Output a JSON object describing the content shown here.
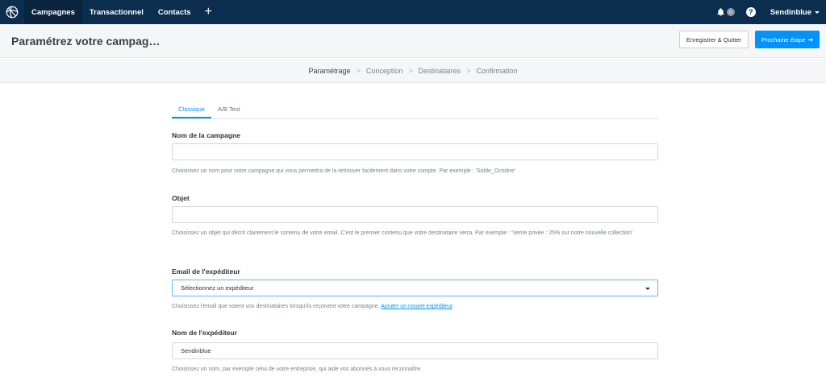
{
  "nav": {
    "items": [
      {
        "label": "Campagnes",
        "active": true
      },
      {
        "label": "Transactionnel",
        "active": false
      },
      {
        "label": "Contacts",
        "active": false
      }
    ],
    "plus_icon": "plus-icon",
    "notification_count": "0",
    "help_icon": "?",
    "account_label": "Sendinblue"
  },
  "header": {
    "title": "Paramétrez votre campag…",
    "save_label": "Enregistrer & Quitter",
    "next_label": "Prochaine étape",
    "next_arrow": "➔"
  },
  "stepper": {
    "steps": [
      "Paramétrage",
      "Conception",
      "Destinataires",
      "Confirmation"
    ],
    "active_index": 0,
    "separator": ">"
  },
  "form": {
    "tabs": [
      {
        "label": "Classique",
        "active": true
      },
      {
        "label": "A/B Test",
        "active": false
      }
    ],
    "fields": {
      "campaign_name": {
        "label": "Nom de la campagne",
        "value": "",
        "help": "Choisissez un nom pour votre campagne qui vous permettra de la retrouver facilement dans votre compte. Par exemple : 'Solde_Octobre'"
      },
      "subject": {
        "label": "Objet",
        "value": "",
        "help": "Choisissez un objet qui décrit clairement le contenu de votre email. C'est le premier contenu que votre destinataire verra. Par exemple : 'Vente privée : 25% sur notre nouvelle collection'"
      },
      "sender_email": {
        "label": "Email de l'expéditeur",
        "selected": "Sélectionnez un expéditeur",
        "help": "Choisissez l'email que voient vos destinataires lorsqu'ils reçoivent votre campagne.",
        "help_link": "Ajouter un nouvel expéditeur",
        "help_suffix": "."
      },
      "sender_name": {
        "label": "Nom de l'expéditeur",
        "value": "Sendinblue",
        "help": "Choisissez un nom, par exemple celui de votre entreprise, qui aide vos abonnés à vous reconnaître."
      }
    }
  },
  "colors": {
    "nav_bg": "#0b2e4f",
    "primary": "#0092ff",
    "header_bg": "#f5f6f8"
  }
}
